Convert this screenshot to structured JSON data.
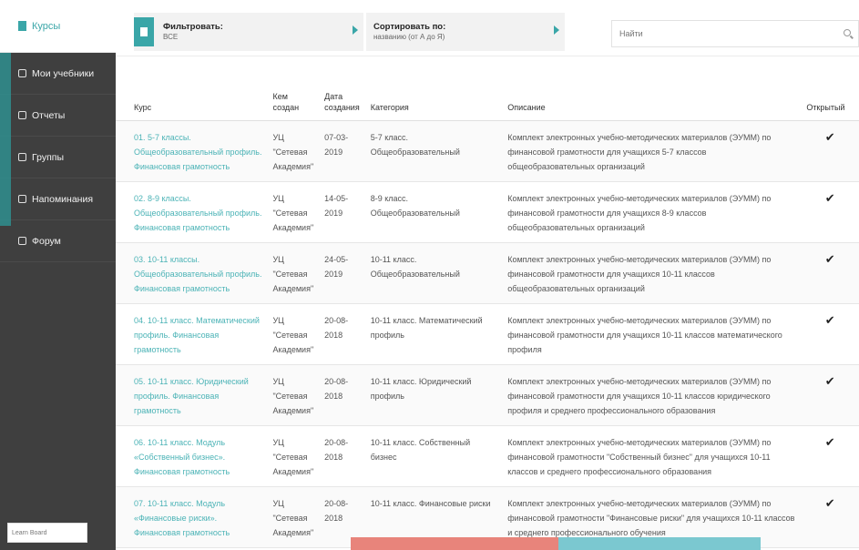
{
  "sidebar": {
    "top_label": "Курсы",
    "items": [
      {
        "label": "Мои учебники",
        "icon": "book-icon"
      },
      {
        "label": "Отчеты",
        "icon": "report-icon"
      },
      {
        "label": "Группы",
        "icon": "group-icon"
      },
      {
        "label": "Напоминания",
        "icon": "bell-icon"
      },
      {
        "label": "Форум",
        "icon": "forum-icon"
      }
    ],
    "footer": "Learn Board"
  },
  "filter": {
    "label": "Фильтровать:",
    "value": "ВСЕ"
  },
  "sort": {
    "label": "Сортировать по:",
    "value": "названию (от А до Я)"
  },
  "search": {
    "placeholder": "Найти"
  },
  "table": {
    "headers": {
      "course": "Курс",
      "created_by": "Кем создан",
      "created_date": "Дата создания",
      "category": "Категория",
      "description": "Описание",
      "open": "Открытый"
    },
    "rows": [
      {
        "course": "01. 5-7 классы. Общеобразовательный профиль. Финансовая грамотность",
        "created_by": "УЦ \"Сетевая Академия\"",
        "date": "07-03-2019",
        "category": "5-7 класс. Общеобразовательный",
        "description": "Комплект электронных учебно-методических материалов (ЭУММ) по финансовой грамотности для учащихся 5-7 классов общеобразовательных организаций",
        "open": "✔"
      },
      {
        "course": "02. 8-9 классы. Общеобразовательный профиль. Финансовая грамотность",
        "created_by": "УЦ \"Сетевая Академия\"",
        "date": "14-05-2019",
        "category": "8-9 класс. Общеобразовательный",
        "description": "Комплект электронных учебно-методических материалов (ЭУММ) по финансовой грамотности для учащихся 8-9 классов общеобразовательных организаций",
        "open": "✔"
      },
      {
        "course": "03. 10-11 классы. Общеобразовательный профиль. Финансовая грамотность",
        "created_by": "УЦ \"Сетевая Академия\"",
        "date": "24-05-2019",
        "category": "10-11 класс. Общеобразовательный",
        "description": "Комплект электронных учебно-методических материалов (ЭУММ) по финансовой грамотности для учащихся 10-11 классов общеобразовательных организаций",
        "open": "✔"
      },
      {
        "course": "04. 10-11 класс. Математический профиль. Финансовая грамотность",
        "created_by": "УЦ \"Сетевая Академия\"",
        "date": "20-08-2018",
        "category": "10-11 класс. Математический профиль",
        "description": "Комплект электронных учебно-методических материалов (ЭУММ) по финансовой грамотности для учащихся 10-11 классов математического профиля",
        "open": "✔"
      },
      {
        "course": "05. 10-11 класс. Юридический профиль. Финансовая грамотность",
        "created_by": "УЦ \"Сетевая Академия\"",
        "date": "20-08-2018",
        "category": "10-11 класс. Юридический профиль",
        "description": "Комплект электронных учебно-методических материалов (ЭУММ) по финансовой грамотности для учащихся 10-11 классов юридического профиля и среднего профессионального образования",
        "open": "✔"
      },
      {
        "course": "06. 10-11 класс. Модуль «Собственный бизнес». Финансовая грамотность",
        "created_by": "УЦ \"Сетевая Академия\"",
        "date": "20-08-2018",
        "category": "10-11 класс. Собственный бизнес",
        "description": "Комплект электронных учебно-методических материалов (ЭУММ) по финансовой грамотности \"Собственный бизнес\" для учащихся 10-11 классов и среднего профессионального образования",
        "open": "✔"
      },
      {
        "course": "07. 10-11 класс. Модуль «Финансовые риски». Финансовая грамотность",
        "created_by": "УЦ \"Сетевая Академия\"",
        "date": "20-08-2018",
        "category": "10-11 класс. Финансовые риски",
        "description": "Комплект электронных учебно-методических материалов (ЭУММ) по финансовой грамотности \"Финансовые риски\" для учащихся 10-11 классов и среднего профессионального обучения",
        "open": "✔"
      }
    ]
  },
  "colors": {
    "accent": "#3aa6a8",
    "link": "#4bb3b6",
    "sidebar_bg": "#3f3f3f"
  }
}
